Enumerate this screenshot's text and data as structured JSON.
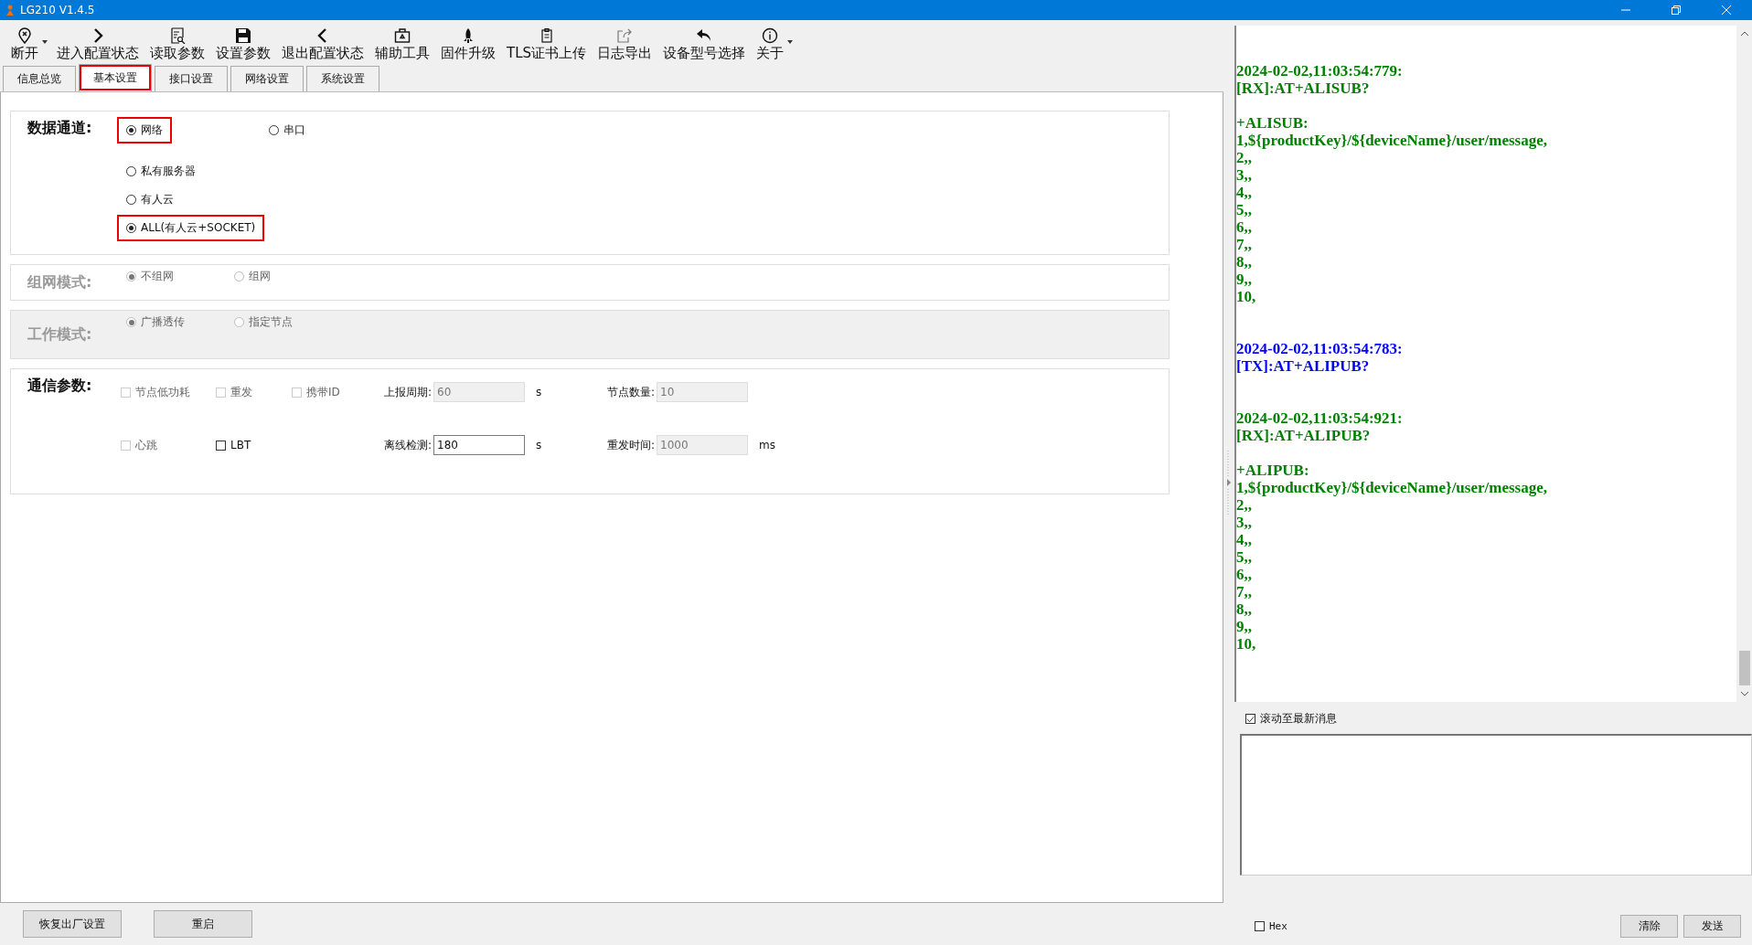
{
  "window": {
    "title": "LG210 V1.4.5"
  },
  "toolbar": [
    {
      "label": "断开",
      "dropdown": true
    },
    {
      "label": "进入配置状态",
      "dropdown": false
    },
    {
      "label": "读取参数",
      "dropdown": false
    },
    {
      "label": "设置参数",
      "dropdown": false
    },
    {
      "label": "退出配置状态",
      "dropdown": false
    },
    {
      "label": "辅助工具",
      "dropdown": false
    },
    {
      "label": "固件升级",
      "dropdown": false
    },
    {
      "label": "TLS证书上传",
      "dropdown": false
    },
    {
      "label": "日志导出",
      "dropdown": false
    },
    {
      "label": "设备型号选择",
      "dropdown": false
    },
    {
      "label": "关于",
      "dropdown": true
    }
  ],
  "tabs": [
    {
      "label": "信息总览",
      "selected": false,
      "highlighted": false
    },
    {
      "label": "基本设置",
      "selected": true,
      "highlighted": true
    },
    {
      "label": "接口设置",
      "selected": false,
      "highlighted": false
    },
    {
      "label": "网络设置",
      "selected": false,
      "highlighted": false
    },
    {
      "label": "系统设置",
      "selected": false,
      "highlighted": false
    }
  ],
  "data_channel": {
    "label": "数据通道:",
    "options": [
      {
        "label": "网络",
        "selected": true,
        "highlighted": true
      },
      {
        "label": "串口",
        "selected": false,
        "highlighted": false
      }
    ],
    "sub_options": [
      {
        "label": "私有服务器",
        "selected": false,
        "highlighted": false
      },
      {
        "label": "有人云",
        "selected": false,
        "highlighted": false
      },
      {
        "label": "ALL(有人云+SOCKET)",
        "selected": true,
        "highlighted": true
      }
    ]
  },
  "network_mode": {
    "label": "组网模式:",
    "disabled": true,
    "options": [
      {
        "label": "不组网",
        "selected": true
      },
      {
        "label": "组网",
        "selected": false
      }
    ]
  },
  "work_mode": {
    "label": "工作模式:",
    "disabled": true,
    "options": [
      {
        "label": "广播透传",
        "selected": true
      },
      {
        "label": "指定节点",
        "selected": false
      }
    ]
  },
  "comm_params": {
    "label": "通信参数:",
    "rows": [
      [
        {
          "kind": "checkbox",
          "label": "节点低功耗",
          "checked": false,
          "disabled": true
        },
        {
          "kind": "checkbox",
          "label": "重发",
          "checked": false,
          "disabled": true
        },
        {
          "kind": "checkbox",
          "label": "携带ID",
          "checked": false,
          "disabled": true
        },
        {
          "kind": "field",
          "label": "上报周期:",
          "value": "60",
          "unit": "s",
          "disabled": true
        },
        {
          "kind": "field",
          "label": "节点数量:",
          "value": "10",
          "disabled": true
        }
      ],
      [
        {
          "kind": "checkbox",
          "label": "心跳",
          "checked": false,
          "disabled": true
        },
        {
          "kind": "checkbox",
          "label": "LBT",
          "checked": false,
          "disabled": false
        },
        "",
        {
          "kind": "field",
          "label": "离线检测:",
          "value": "180",
          "unit": "s",
          "disabled": false
        },
        {
          "kind": "field",
          "label": "重发时间:",
          "value": "1000",
          "unit": "ms",
          "disabled": true
        }
      ]
    ]
  },
  "bottom_buttons": [
    "恢复出厂设置",
    "重启"
  ],
  "log": [
    {
      "kind": "rx",
      "lines": [
        "2024-02-02,11:03:54:779:",
        "[RX]:AT+ALISUB?"
      ],
      "body": [
        "+ALISUB:",
        "1,${productKey}/${deviceName}/user/message,",
        "2,,",
        "3,,",
        "4,,",
        "5,,",
        "6,,",
        "7,,",
        "8,,",
        "9,,",
        "10,"
      ]
    },
    {
      "kind": "tx",
      "lines": [
        "2024-02-02,11:03:54:783:",
        "[TX]:AT+ALIPUB?"
      ]
    },
    {
      "kind": "rx",
      "lines": [
        "2024-02-02,11:03:54:921:",
        "[RX]:AT+ALIPUB?"
      ],
      "body": [
        "+ALIPUB:",
        "1,${productKey}/${deviceName}/user/message,",
        "2,,",
        "3,,",
        "4,,",
        "5,,",
        "6,,",
        "7,,",
        "8,,",
        "9,,",
        "10,"
      ]
    }
  ],
  "scroll_latest": {
    "label": "滚动至最新消息",
    "checked": true
  },
  "hex": {
    "label": "Hex",
    "checked": false
  },
  "send_buttons": [
    "清除",
    "发送"
  ]
}
